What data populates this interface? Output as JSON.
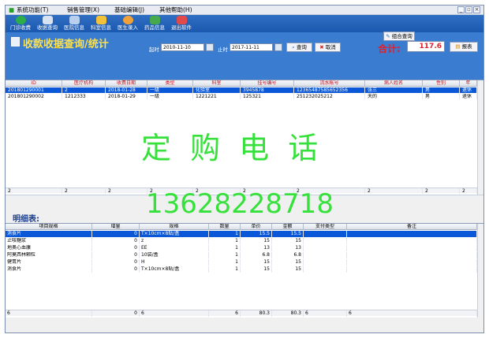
{
  "menus": [
    "系统功能(T)",
    "销售管理(X)",
    "基础编辑(J)",
    "其他帮助(H)"
  ],
  "toolbar": [
    "门诊收费",
    "收据查询",
    "医院信息",
    "科室信息",
    "医生录入",
    "药品信息",
    "退出软件"
  ],
  "query": {
    "title": "收款收据查询/统计",
    "start_label": "起时",
    "start_value": "2010-11-10",
    "end_label": "止时",
    "end_value": "2017-11-11",
    "search_btn": "查询",
    "cancel_btn": "取消",
    "combo_btn": "组合查询",
    "total_label": "合计:",
    "total_value": "117.6",
    "report_btn": "报表"
  },
  "grid1": {
    "headers": [
      "ID",
      "医疗机构",
      "收费日期",
      "类型",
      "科室",
      "挂号编号",
      "流水帐号",
      "病人姓名",
      "性别",
      "年"
    ],
    "rows": [
      [
        "201801290001",
        "2",
        "2018-01-28",
        "一级",
        "化验室",
        "3945878",
        "12365487585652356",
        "张三",
        "男",
        "退休"
      ],
      [
        "201801290002",
        "1212333",
        "2018-01-29",
        "一级",
        "1221221",
        "125321",
        "251232025212",
        "天的",
        "男",
        "退休"
      ]
    ],
    "footer": [
      "2",
      "2",
      "2",
      "2",
      "2",
      "2",
      "2",
      "2",
      "2",
      "2"
    ]
  },
  "watermark": {
    "text1": "定 购 电 话",
    "text2": "13628228718"
  },
  "detail": {
    "title": "明细表:",
    "headers": [
      "项目规格",
      "增量",
      "规格",
      "数量",
      "单价",
      "金额",
      "支付类型",
      "备注"
    ],
    "rows": [
      [
        "消食片",
        "0",
        "T×10cm×8贴/盒",
        "1",
        "15.5",
        "15.5",
        "",
        ""
      ],
      [
        "止咳糖浆",
        "0",
        "z",
        "1",
        "15",
        "15",
        "",
        ""
      ],
      [
        "地奥心血康",
        "0",
        "EE",
        "1",
        "13",
        "13",
        "",
        ""
      ],
      [
        "阿莫西林颗粒",
        "0",
        "10袋/盒",
        "1",
        "6.8",
        "6.8",
        "",
        ""
      ],
      [
        "健胃片",
        "0",
        "H",
        "1",
        "15",
        "15",
        "",
        ""
      ],
      [
        "消食片",
        "0",
        "T×10cm×8贴/盒",
        "1",
        "15",
        "15",
        "",
        ""
      ]
    ],
    "footer": [
      "6",
      "0",
      "6",
      "6",
      "80.3",
      "80.3",
      "6",
      "6"
    ]
  },
  "colors": {
    "toolbar": "#1b58b0",
    "selection": "#0a58d8",
    "total": "#e0202c",
    "watermark": "#35e13a"
  }
}
